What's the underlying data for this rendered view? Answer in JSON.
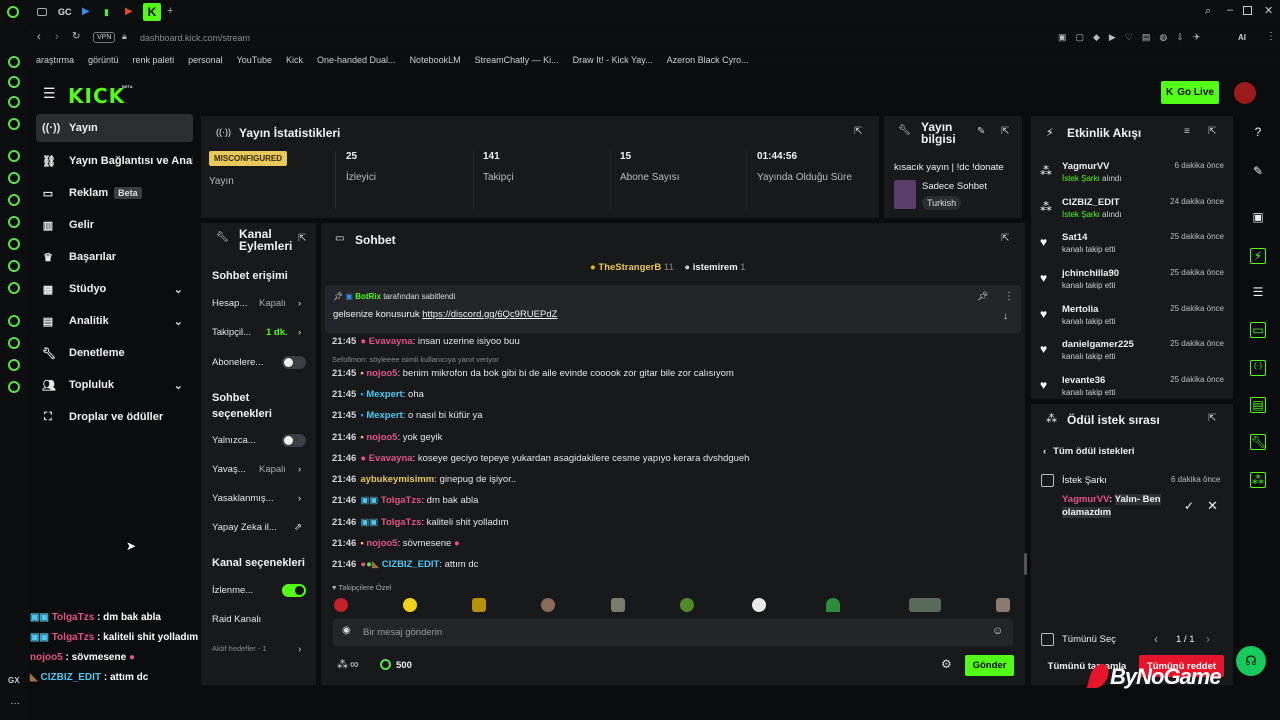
{
  "browser": {
    "tabs": [
      "GC"
    ],
    "url_host": "dashboard.kick.com",
    "url_path": "/stream",
    "vpn": "VPN",
    "bookmarks": [
      "araştırma",
      "görüntü",
      "renk paleti",
      "personal",
      "YouTube",
      "Kick",
      "One-handed Dual...",
      "NotebookLM",
      "StreamChatly — Ki...",
      "Draw It! - Kick Yay...",
      "Azeron Black Cyro..."
    ]
  },
  "header": {
    "logo": "KICK",
    "logo_sup": "BETA",
    "go_live": "Go Live"
  },
  "sidebar": {
    "items": [
      {
        "label": "Yayın",
        "icon": "broadcast-icon"
      },
      {
        "label": "Yayın Bağlantısı ve Anahtar",
        "icon": "link-icon"
      },
      {
        "label": "Reklam",
        "icon": "ad-icon",
        "badge": "Beta"
      },
      {
        "label": "Gelir",
        "icon": "chart-icon"
      },
      {
        "label": "Başarılar",
        "icon": "trophy-icon"
      },
      {
        "label": "Stüdyo",
        "icon": "studio-icon"
      },
      {
        "label": "Analitik",
        "icon": "analytics-icon"
      },
      {
        "label": "Denetleme",
        "icon": "wrench-icon"
      },
      {
        "label": "Topluluk",
        "icon": "community-icon"
      },
      {
        "label": "Droplar ve ödüller",
        "icon": "drops-icon"
      }
    ]
  },
  "stats": {
    "title": "Yayın İstatistikleri",
    "status": "MISCONFIGURED",
    "status_label": "Yayın",
    "viewers": "25",
    "viewers_label": "İzleyici",
    "followers": "141",
    "followers_label": "Takipçi",
    "subs": "15",
    "subs_label": "Abone Sayısı",
    "uptime": "01:44:56",
    "uptime_label": "Yayında Olduğu Süre"
  },
  "stream_info": {
    "title_line1": "Yayın",
    "title_line2": "bilgisi",
    "stream_title": "kısacık yayın | !dc !donate",
    "category": "Sadece Sohbet",
    "language": "Turkish"
  },
  "activity": {
    "title": "Etkinlik Akışı",
    "rows": [
      {
        "name": "YagmurVV",
        "desc_hl": "İstek Şarkı",
        "desc": " alındı",
        "time": "6 dakika önce"
      },
      {
        "name": "CIZBIZ_EDIT",
        "desc_hl": "İstek Şarkı",
        "desc": " alındı",
        "time": "24 dakika önce"
      },
      {
        "name": "Sat14",
        "desc_hl": "",
        "desc": "kanalı takip etti",
        "time": "25 dakika önce"
      },
      {
        "name": "jchinchilla90",
        "desc_hl": "",
        "desc": "kanalı takip etti",
        "time": "25 dakika önce"
      },
      {
        "name": "Mertolia",
        "desc_hl": "",
        "desc": "kanalı takip etti",
        "time": "25 dakika önce"
      },
      {
        "name": "danielgamer225",
        "desc_hl": "",
        "desc": "kanalı takip etti",
        "time": "25 dakika önce"
      },
      {
        "name": "levante36",
        "desc_hl": "",
        "desc": "kanalı takip etti",
        "time": "25 dakika önce"
      }
    ]
  },
  "rewards": {
    "title": "Ödül istek sırası",
    "back": "Tüm ödül istekleri",
    "item_title": "İstek Şarkı",
    "item_time": "6 dakika önce",
    "item_user": "YagmurVV",
    "item_text": "Yalın- Ben olamazdım",
    "select_all": "Tümünü Seç",
    "page": "1 / 1",
    "accept_all": "Tümünü tamamla",
    "reject_all": "Tümünü reddet"
  },
  "channel_actions": {
    "title_line1": "Kanal",
    "title_line2": "Eylemleri",
    "chat_access": "Sohbet erişimi",
    "account_age": "Hesap...",
    "account_age_val": "Kapalı",
    "follower_only": "Takipçil...",
    "follower_only_val": "1 dk.",
    "subs_only": "Abonelere...",
    "chat_options_1": "Sohbet",
    "chat_options_2": "seçenekleri",
    "only": "Yalnızca...",
    "slow": "Yavaş...",
    "slow_val": "Kapalı",
    "banned": "Yasaklanmış...",
    "ai": "Yapay Zeka il...",
    "channel_options": "Kanal seçenekleri",
    "watching": "İzlenme...",
    "raid": "Raid Kanalı",
    "active_goals": "Aktif hedefler - 1"
  },
  "chat": {
    "title": "Sohbet",
    "top1_name": "TheStrangerB",
    "top1_count": "11",
    "top2_name": "istemirem",
    "top2_count": "1",
    "pinned_by": "BotRix",
    "pinned_suffix": "tarafından sabitlendi",
    "pinned_msg": "gelsenize konusuruk ",
    "pinned_link": "https://discord.gg/6Qc9RUEPdZ",
    "reply_hint": "Sefollmon: söyleeee isimli kullanıcıya yanıt veriyor",
    "messages": [
      {
        "t": "21:45",
        "u": "Evavayna",
        "c": "#e05585",
        "m": "insan uzerine isiyoo buu"
      },
      {
        "t": "21:45",
        "u": "nojoo5",
        "c": "#e05585",
        "m": "benim mikrofon da bok gibi bi de aile evinde cooook zor gitar bile zor calısıyom"
      },
      {
        "t": "21:45",
        "u": "Mexpert",
        "c": "#4fc8f0",
        "m": "oha"
      },
      {
        "t": "21:45",
        "u": "Mexpert",
        "c": "#4fc8f0",
        "m": "o nasıl bi küfür ya"
      },
      {
        "t": "21:46",
        "u": "nojoo5",
        "c": "#e05585",
        "m": "yok geyik"
      },
      {
        "t": "21:46",
        "u": "Evavayna",
        "c": "#e05585",
        "m": "koseye geciyo tepeye yukardan asagidakilere cesme yapıyo kerara dvshdgueh"
      },
      {
        "t": "21:46",
        "u": "aybukeymisimm",
        "c": "#e8c85a",
        "m": "ginepug de işiyor.."
      },
      {
        "t": "21:46",
        "u": "TolgaTzs",
        "c": "#e05585",
        "m": "dm bak abla"
      },
      {
        "t": "21:46",
        "u": "TolgaTzs",
        "c": "#e05585",
        "m": "kaliteli shit yolladım"
      },
      {
        "t": "21:46",
        "u": "nojoo5",
        "c": "#e05585",
        "m": "sövmesene"
      },
      {
        "t": "21:46",
        "u": "CIZBIZ_EDIT",
        "c": "#4fc8f0",
        "m": "attım dc"
      }
    ],
    "followers_only": "Takipçilere Özel",
    "placeholder": "Bir mesaj gönderin",
    "points": "500",
    "send": "Gönder"
  },
  "overlay": {
    "lines": [
      {
        "u": "TolgaTzs",
        "m": "dm bak abla"
      },
      {
        "u": "TolgaTzs",
        "m": "kaliteli shit yolladım"
      },
      {
        "u": "nojoo5",
        "m": "sövmesene"
      },
      {
        "u": "CIZBIZ_EDIT",
        "m": "attım dc"
      }
    ]
  },
  "watermark": "ByNoGame",
  "colors": {
    "brand": "#53fc18",
    "danger": "#e5152b"
  }
}
